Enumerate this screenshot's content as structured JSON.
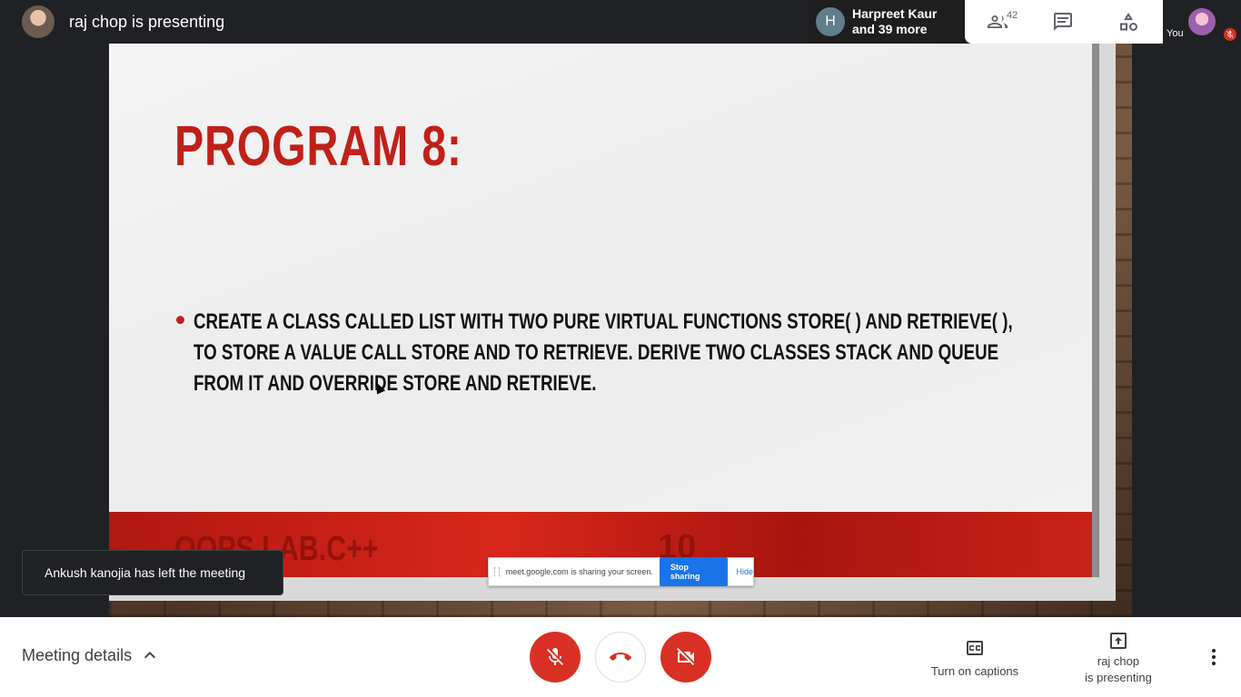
{
  "header": {
    "presenting_title": "raj chop is presenting",
    "participants_chip": {
      "initial": "H",
      "line1": "Harpreet Kaur",
      "line2": "and 39 more"
    },
    "people_count": "42",
    "self_label": "You"
  },
  "slide": {
    "title": "PROGRAM 8:",
    "bullet": "CREATE A CLASS CALLED LIST WITH TWO PURE VIRTUAL FUNCTIONS STORE( ) AND RETRIEVE( ), TO STORE A VALUE CALL STORE AND TO RETRIEVE. DERIVE TWO CLASSES STACK AND QUEUE FROM IT AND OVERRIDE STORE AND RETRIEVE.",
    "footer_text": "OOPS LAB.C++",
    "page_number": "10"
  },
  "share_bar": {
    "message": "meet.google.com is sharing your screen.",
    "stop_label": "Stop sharing",
    "hide_label": "Hide"
  },
  "toast": {
    "message": "Ankush kanojia has left the meeting"
  },
  "bottom": {
    "meeting_details": "Meeting details",
    "captions_label": "Turn on captions",
    "present_line1": "raj chop",
    "present_line2": "is presenting"
  },
  "colors": {
    "mute_red": "#d93025",
    "accent_blue": "#1a73e8",
    "slide_red": "#c0201a"
  },
  "icons": [
    "people-icon",
    "chat-icon",
    "activities-icon",
    "mic-off-icon",
    "hang-up-icon",
    "camera-off-icon",
    "captions-icon",
    "present-icon",
    "more-vert-icon",
    "chevron-up-icon"
  ]
}
